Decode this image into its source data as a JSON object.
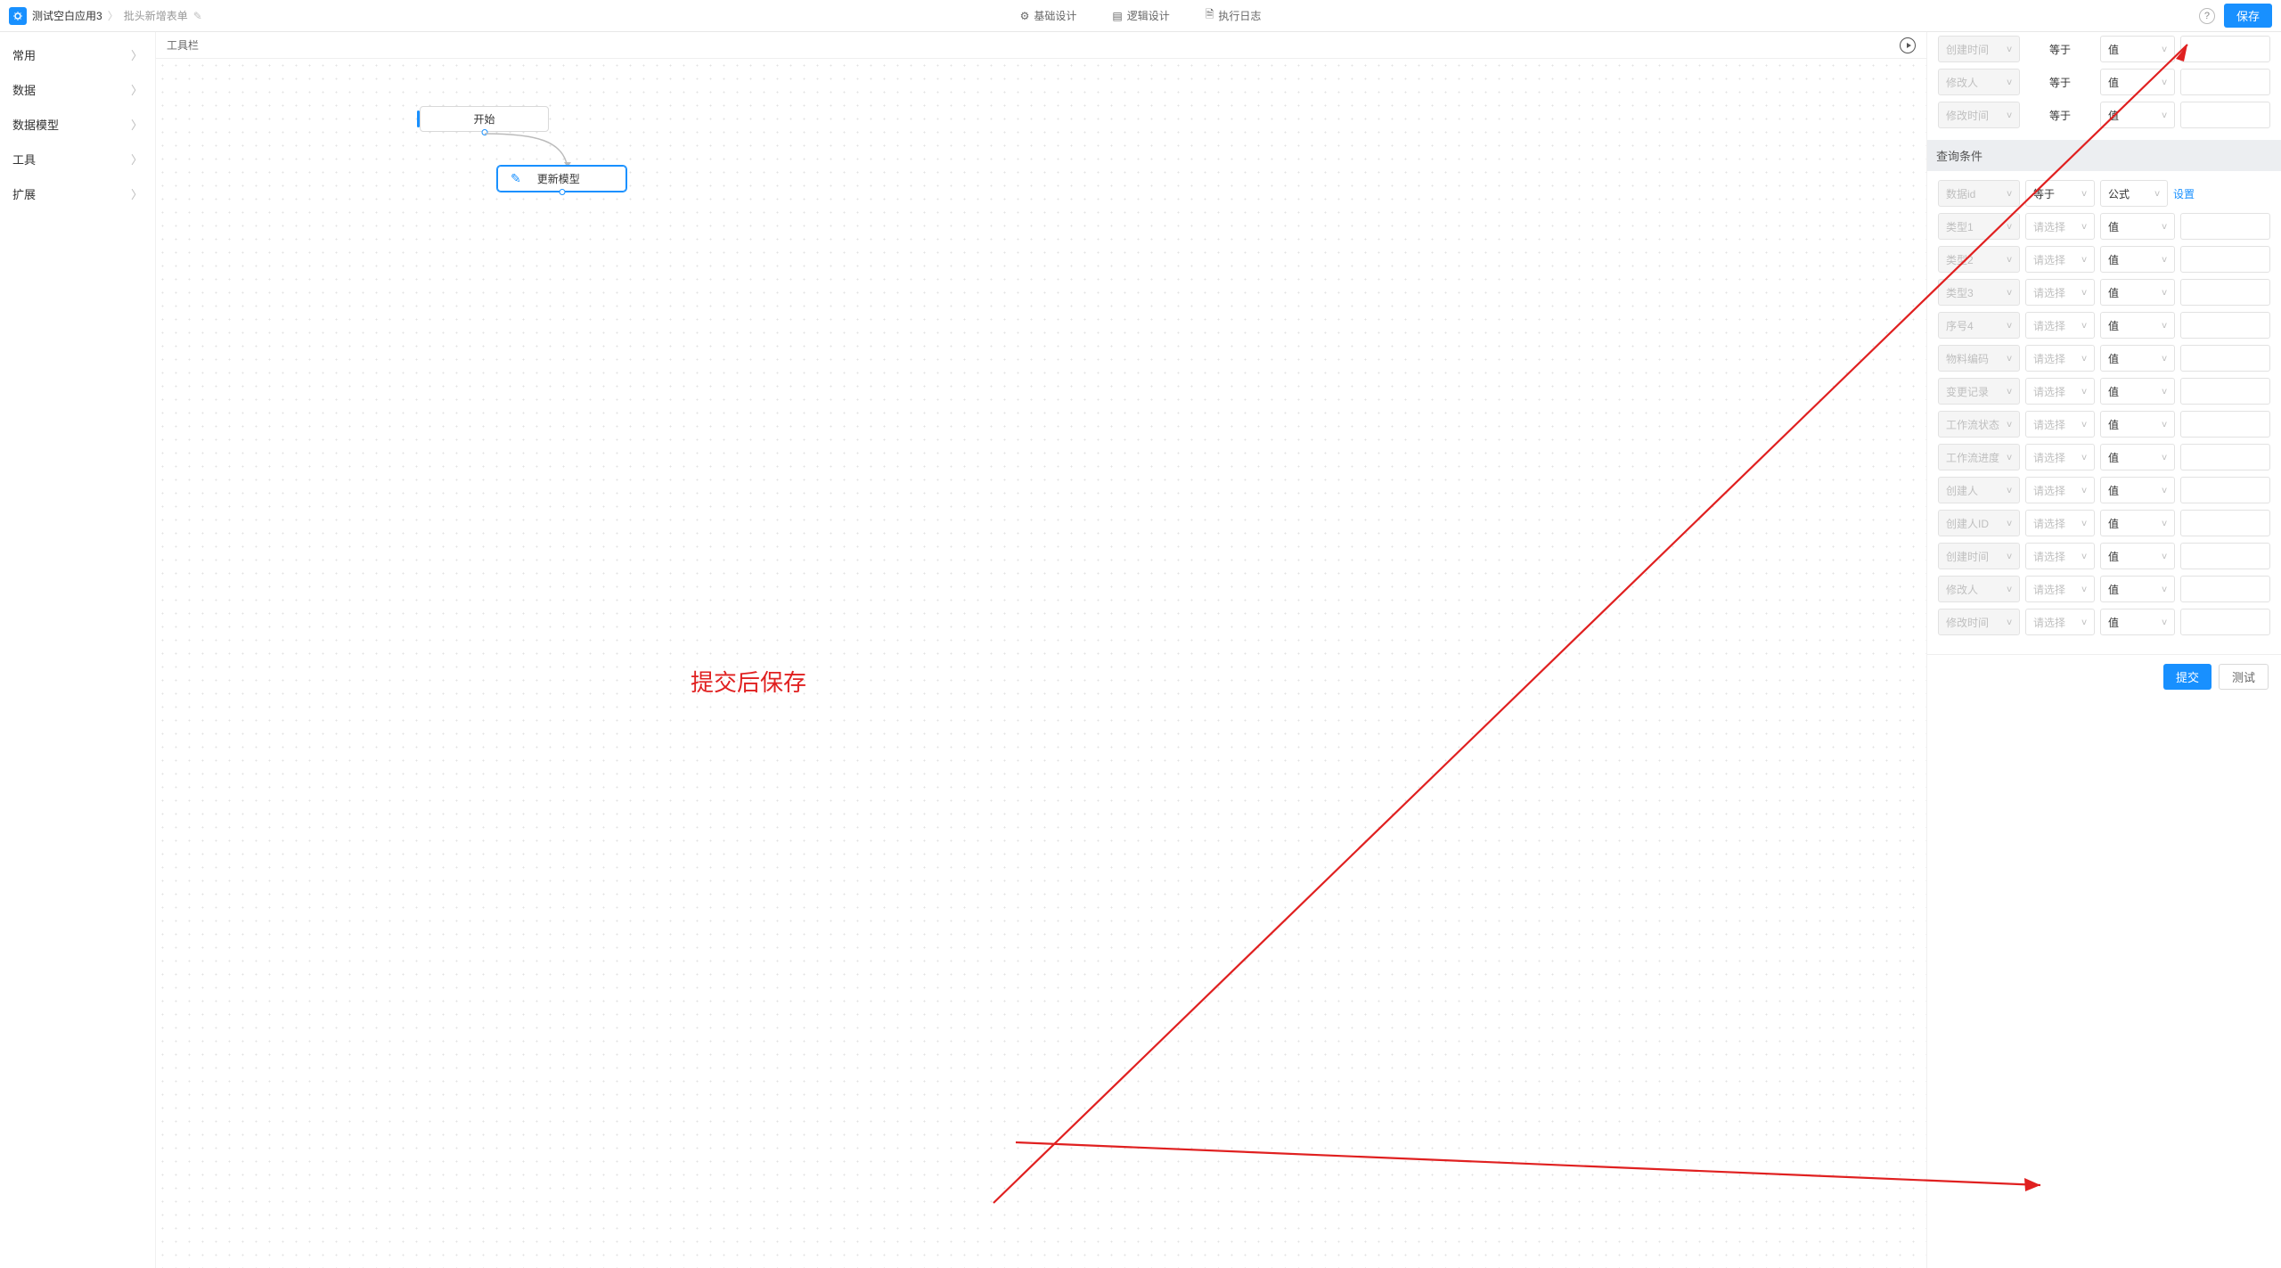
{
  "header": {
    "app_name": "测试空白应用3",
    "page_name": "批头新增表单",
    "tabs": {
      "basic": "基础设计",
      "logic": "逻辑设计",
      "log": "执行日志"
    },
    "save": "保存"
  },
  "left_nav": {
    "items": [
      {
        "label": "常用"
      },
      {
        "label": "数据"
      },
      {
        "label": "数据模型"
      },
      {
        "label": "工具"
      },
      {
        "label": "扩展"
      }
    ]
  },
  "canvas": {
    "toolbar_title": "工具栏",
    "nodes": {
      "start": "开始",
      "update": "更新模型"
    }
  },
  "right": {
    "top_rows": [
      {
        "field": "创建时间",
        "op": "等于",
        "val": "值"
      },
      {
        "field": "修改人",
        "op": "等于",
        "val": "值"
      },
      {
        "field": "修改时间",
        "op": "等于",
        "val": "值"
      }
    ],
    "section_title": "查询条件",
    "first_row": {
      "field": "数据id",
      "op": "等于",
      "val": "公式",
      "action": "设置"
    },
    "rows": [
      {
        "field": "类型1",
        "op_ph": "请选择",
        "val": "值"
      },
      {
        "field": "类型2",
        "op_ph": "请选择",
        "val": "值"
      },
      {
        "field": "类型3",
        "op_ph": "请选择",
        "val": "值"
      },
      {
        "field": "序号4",
        "op_ph": "请选择",
        "val": "值"
      },
      {
        "field": "物料编码",
        "op_ph": "请选择",
        "val": "值"
      },
      {
        "field": "变更记录",
        "op_ph": "请选择",
        "val": "值"
      },
      {
        "field": "工作流状态",
        "op_ph": "请选择",
        "val": "值"
      },
      {
        "field": "工作流进度",
        "op_ph": "请选择",
        "val": "值"
      },
      {
        "field": "创建人",
        "op_ph": "请选择",
        "val": "值"
      },
      {
        "field": "创建人ID",
        "op_ph": "请选择",
        "val": "值"
      },
      {
        "field": "创建时间",
        "op_ph": "请选择",
        "val": "值"
      },
      {
        "field": "修改人",
        "op_ph": "请选择",
        "val": "值"
      },
      {
        "field": "修改时间",
        "op_ph": "请选择",
        "val": "值"
      }
    ],
    "footer": {
      "submit": "提交",
      "test": "测试"
    }
  },
  "annotation": {
    "text": "提交后保存"
  }
}
